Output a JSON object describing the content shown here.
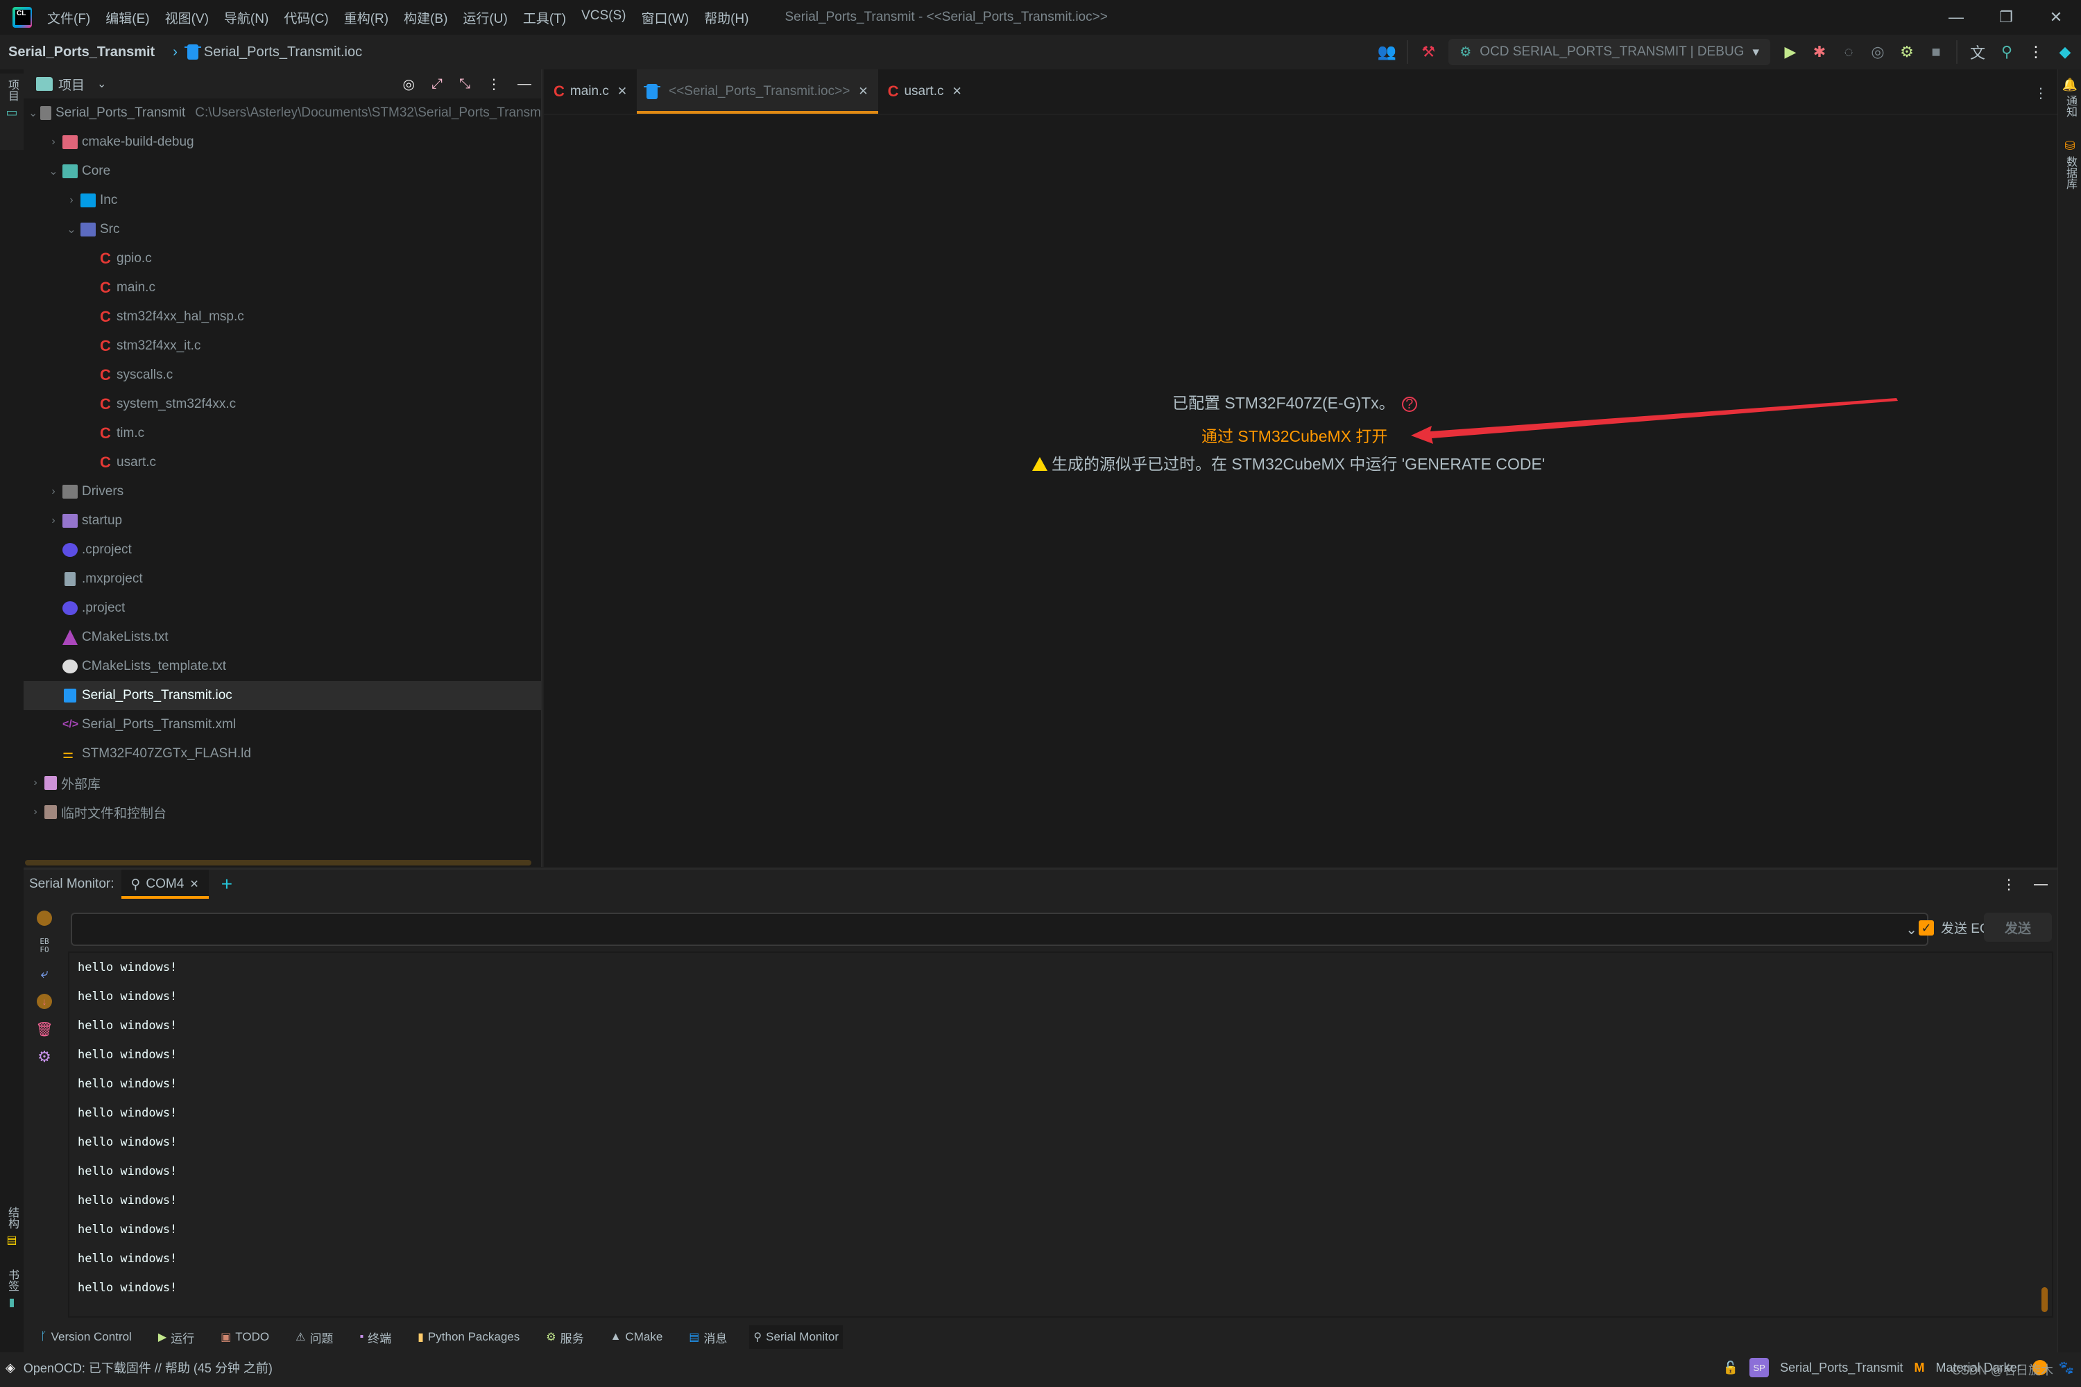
{
  "app": {
    "menu": [
      "文件(F)",
      "编辑(E)",
      "视图(V)",
      "导航(N)",
      "代码(C)",
      "重构(R)",
      "构建(B)",
      "运行(U)",
      "工具(T)",
      "VCS(S)",
      "窗口(W)",
      "帮助(H)"
    ],
    "window_title": "Serial_Ports_Transmit - <<Serial_Ports_Transmit.ioc>>"
  },
  "navbar": {
    "project": "Serial_Ports_Transmit",
    "file": "Serial_Ports_Transmit.ioc",
    "run_config": "OCD SERIAL_PORTS_TRANSMIT | DEBUG"
  },
  "left_strip": {
    "project_label": "项目",
    "structure_label": "结构",
    "bookmarks_label": "书签"
  },
  "right_strip": {
    "notifications_label": "通知",
    "database_label": "数据库"
  },
  "project_panel": {
    "title": "项目",
    "root_name": "Serial_Ports_Transmit",
    "root_path": "C:\\Users\\Asterley\\Documents\\STM32\\Serial_Ports_Transm",
    "tree": [
      {
        "name": "cmake-build-debug",
        "type": "folder-red",
        "depth": 1,
        "expanded": false
      },
      {
        "name": "Core",
        "type": "folder-teal",
        "depth": 1,
        "expanded": true
      },
      {
        "name": "Inc",
        "type": "folder-blue",
        "depth": 2,
        "expanded": false
      },
      {
        "name": "Src",
        "type": "folder-src",
        "depth": 2,
        "expanded": true
      },
      {
        "name": "gpio.c",
        "type": "c-file",
        "depth": 3
      },
      {
        "name": "main.c",
        "type": "c-file",
        "depth": 3
      },
      {
        "name": "stm32f4xx_hal_msp.c",
        "type": "c-file",
        "depth": 3
      },
      {
        "name": "stm32f4xx_it.c",
        "type": "c-file",
        "depth": 3
      },
      {
        "name": "syscalls.c",
        "type": "c-file",
        "depth": 3
      },
      {
        "name": "system_stm32f4xx.c",
        "type": "c-file",
        "depth": 3
      },
      {
        "name": "tim.c",
        "type": "c-file",
        "depth": 3
      },
      {
        "name": "usart.c",
        "type": "c-file",
        "depth": 3
      },
      {
        "name": "Drivers",
        "type": "folder-gray",
        "depth": 1,
        "expanded": false
      },
      {
        "name": "startup",
        "type": "folder-startup",
        "depth": 1,
        "expanded": false
      },
      {
        "name": ".cproject",
        "type": "eclipse",
        "depth": 1
      },
      {
        "name": ".mxproject",
        "type": "doc",
        "depth": 1
      },
      {
        "name": ".project",
        "type": "eclipse",
        "depth": 1
      },
      {
        "name": "CMakeLists.txt",
        "type": "cmake",
        "depth": 1
      },
      {
        "name": "CMakeLists_template.txt",
        "type": "github",
        "depth": 1
      },
      {
        "name": "Serial_Ports_Transmit.ioc",
        "type": "ioc",
        "depth": 1,
        "selected": true
      },
      {
        "name": "Serial_Ports_Transmit.xml",
        "type": "xml",
        "depth": 1
      },
      {
        "name": "STM32F407ZGTx_FLASH.ld",
        "type": "ld",
        "depth": 1
      },
      {
        "name": "外部库",
        "type": "lib",
        "depth": 0,
        "expanded": false
      },
      {
        "name": "临时文件和控制台",
        "type": "scratch",
        "depth": 0,
        "expanded": false
      }
    ]
  },
  "editor": {
    "tabs": [
      {
        "label": "main.c",
        "icon": "c-file",
        "active": false
      },
      {
        "label": "<<Serial_Ports_Transmit.ioc>>",
        "icon": "ioc",
        "active": true
      },
      {
        "label": "usart.c",
        "icon": "c-file",
        "active": false
      }
    ],
    "configured_text": "已配置 STM32F407Z(E-G)Tx。",
    "open_link": "通过 STM32CubeMX 打开",
    "warning_text": "生成的源似乎已过时。在 STM32CubeMX 中运行 'GENERATE CODE'"
  },
  "serial_monitor": {
    "label": "Serial Monitor:",
    "tab": "COM4",
    "input_value": "",
    "eol_label": "发送 EOL",
    "eol_checked": true,
    "send_label": "发送",
    "ebfo_label": "EB\nFO",
    "output": [
      "hello windows!",
      "hello windows!",
      "hello windows!",
      "hello windows!",
      "hello windows!",
      "hello windows!",
      "hello windows!",
      "hello windows!",
      "hello windows!",
      "hello windows!",
      "hello windows!",
      "hello windows!"
    ]
  },
  "tool_windows": [
    {
      "label": "Version Control",
      "icon": "branch-icon",
      "color": "#4fc3f7",
      "glyph": "ᚴ"
    },
    {
      "label": "运行",
      "icon": "run-icon",
      "color": "#c3e88d",
      "glyph": "▶"
    },
    {
      "label": "TODO",
      "icon": "todo-icon",
      "color": "#d08770",
      "glyph": "▣"
    },
    {
      "label": "问题",
      "icon": "problems-icon",
      "color": "#b0bec5",
      "glyph": "⚠"
    },
    {
      "label": "终端",
      "icon": "terminal-icon",
      "color": "#c792ea",
      "glyph": "▪"
    },
    {
      "label": "Python Packages",
      "icon": "python-packages-icon",
      "color": "#ffcb6b",
      "glyph": "▮"
    },
    {
      "label": "服务",
      "icon": "services-icon",
      "color": "#c3e88d",
      "glyph": "⚙"
    },
    {
      "label": "CMake",
      "icon": "cmake-icon",
      "color": "#b0bec5",
      "glyph": "▲"
    },
    {
      "label": "消息",
      "icon": "messages-icon",
      "color": "#2196f3",
      "glyph": "▤"
    },
    {
      "label": "Serial Monitor",
      "icon": "serial-monitor-icon",
      "color": "#b0bec5",
      "glyph": "⚲",
      "active": true
    }
  ],
  "statusbar": {
    "message": "OpenOCD: 已下载固件 // 帮助 (45 分钟 之前)",
    "project_badge": "SP",
    "project_name": "Serial_Ports_Transmit",
    "theme": "Material Darker",
    "watermark": "CSDN @名日旋木"
  },
  "colors": {
    "accent": "#ff9800",
    "tab_underline": "#e08a14",
    "link": "#ff9800",
    "error": "#e53950",
    "warning": "#ffd600",
    "background": "#212121",
    "panel": "#1a1a1a"
  }
}
